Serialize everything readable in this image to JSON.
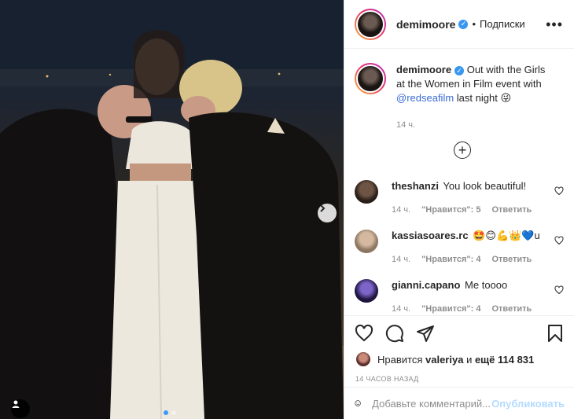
{
  "post": {
    "username": "demimoore",
    "follow_label": "Подписки",
    "more_label": "•••"
  },
  "caption": {
    "username": "demimoore",
    "text_before": "Out with the Girls at the Women in Film event with",
    "mention": "@redseafilm",
    "text_after": "last night 😜",
    "time": "14 ч."
  },
  "comments": [
    {
      "username": "theshanzi",
      "text": "You look beautiful!",
      "time": "14 ч.",
      "likes": "\"Нравится\": 5",
      "reply": "Ответить",
      "avatar_color": "#4a3a2e"
    },
    {
      "username": "kassiasoares.rc",
      "text": "🤩😊💪👑💙u",
      "time": "14 ч.",
      "likes": "\"Нравится\": 4",
      "reply": "Ответить",
      "avatar_color": "#b9a58f"
    },
    {
      "username": "gianni.capano",
      "text": "Me toooo",
      "time": "14 ч.",
      "likes": "\"Нравится\": 4",
      "reply": "Ответить",
      "avatar_color": "#3a2a6b"
    }
  ],
  "likes_line": {
    "prefix": "Нравится",
    "user": "valeriya",
    "middle": "и",
    "count": "ещё 114 831"
  },
  "posted_ago": "14 ЧАСОВ НАЗАД",
  "add_comment": {
    "placeholder": "Добавьте комментарий...",
    "publish": "Опубликовать"
  },
  "colors": {
    "accent": "#3897f0",
    "publish_disabled": "#b3dbff",
    "muted": "#8e8e8e"
  }
}
